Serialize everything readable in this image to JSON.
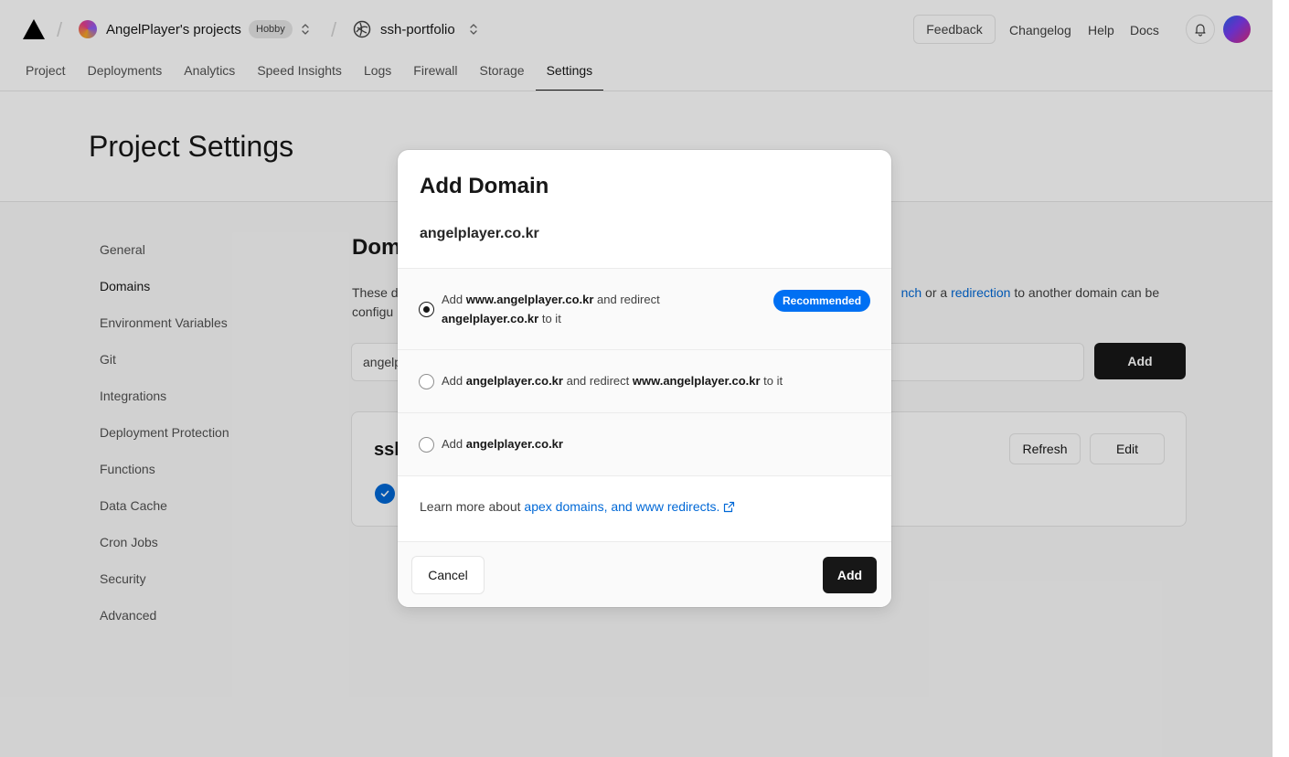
{
  "header": {
    "team_name": "AngelPlayer's projects",
    "plan_badge": "Hobby",
    "project_name": "ssh-portfolio",
    "feedback_label": "Feedback",
    "links": [
      "Changelog",
      "Help",
      "Docs"
    ]
  },
  "tabs": [
    {
      "label": "Project"
    },
    {
      "label": "Deployments"
    },
    {
      "label": "Analytics"
    },
    {
      "label": "Speed Insights"
    },
    {
      "label": "Logs"
    },
    {
      "label": "Firewall"
    },
    {
      "label": "Storage"
    },
    {
      "label": "Settings",
      "active": true
    }
  ],
  "page": {
    "title": "Project Settings"
  },
  "sidebar": {
    "items": [
      {
        "label": "General"
      },
      {
        "label": "Domains",
        "active": true
      },
      {
        "label": "Environment Variables"
      },
      {
        "label": "Git"
      },
      {
        "label": "Integrations"
      },
      {
        "label": "Deployment Protection"
      },
      {
        "label": "Functions"
      },
      {
        "label": "Data Cache"
      },
      {
        "label": "Cron Jobs"
      },
      {
        "label": "Security"
      },
      {
        "label": "Advanced"
      }
    ]
  },
  "domains_section": {
    "title_visible": "Dom",
    "desc_line1_start": "These d",
    "desc_link1": "nch",
    "desc_or": " or a ",
    "desc_link2": "redirection",
    "desc_line1_end": " to another domain can be",
    "desc_line2": "configu",
    "input_value": "angelp",
    "add_label": "Add",
    "card_title_visible": "ssh",
    "refresh_label": "Refresh",
    "edit_label": "Edit"
  },
  "modal": {
    "title": "Add Domain",
    "domain": "angelplayer.co.kr",
    "recommended_badge": "Recommended",
    "options": [
      {
        "prefix": "Add ",
        "bold1": "www.angelplayer.co.kr",
        "mid": " and redirect",
        "bold2": "angelplayer.co.kr",
        "suffix": " to it",
        "checked": true
      },
      {
        "prefix": "Add ",
        "bold1": "angelplayer.co.kr",
        "mid": " and redirect ",
        "bold2": "www.angelplayer.co.kr",
        "suffix": " to it",
        "checked": false
      },
      {
        "prefix": "Add ",
        "bold1": "angelplayer.co.kr",
        "checked": false
      }
    ],
    "learn_prefix": "Learn more about ",
    "learn_link": "apex domains, and www redirects.",
    "cancel_label": "Cancel",
    "add_label": "Add"
  },
  "colors": {
    "accent_blue": "#0070f3",
    "link_blue": "#0068d6",
    "primary_black": "#171717"
  }
}
